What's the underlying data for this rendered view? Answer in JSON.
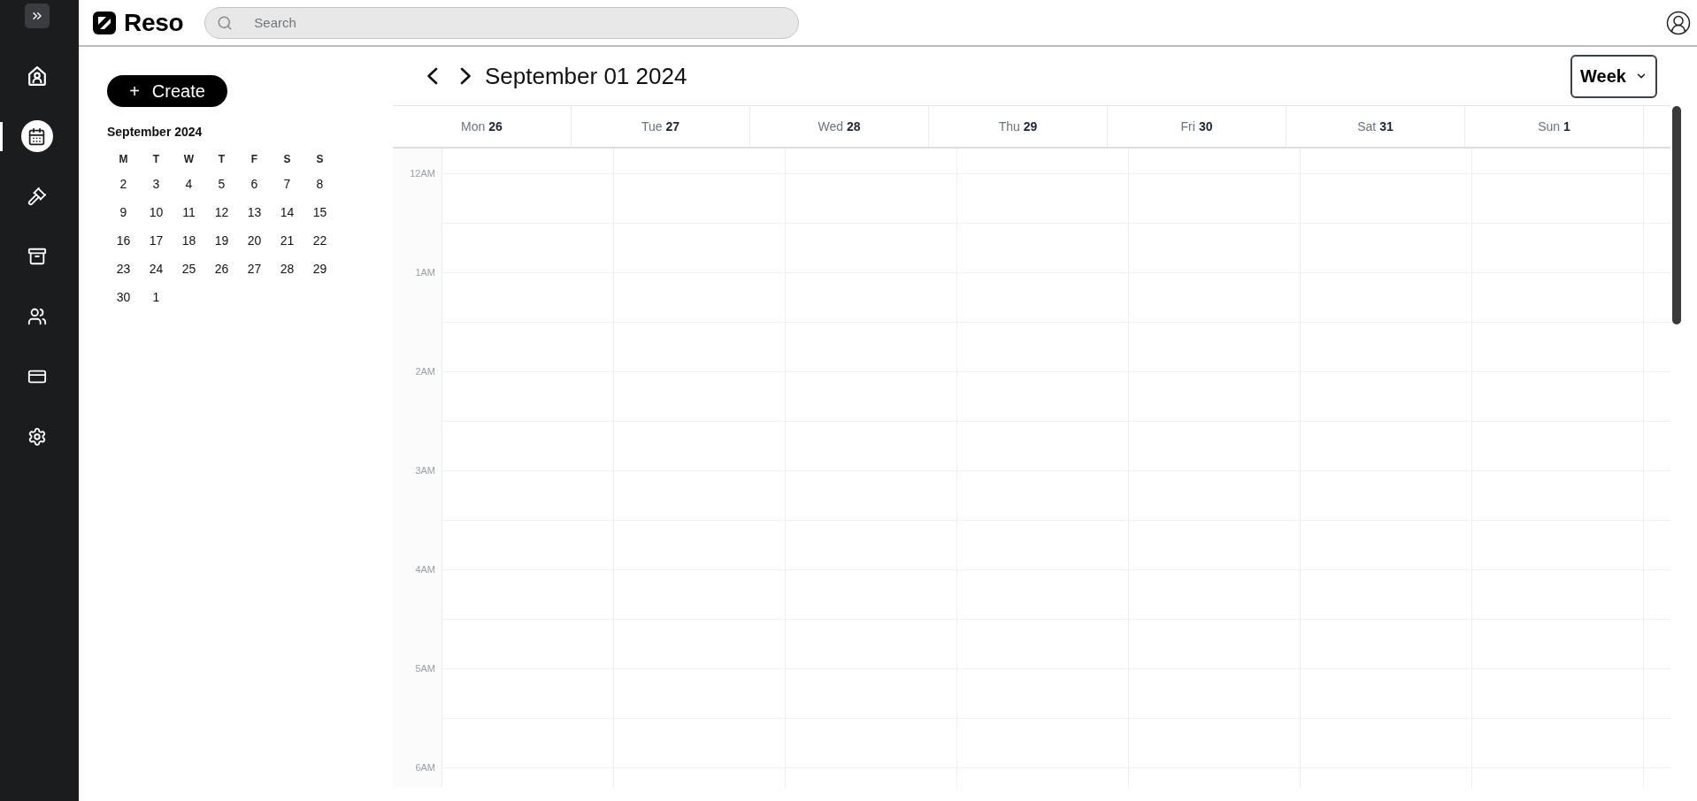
{
  "sidebar": {
    "items": [
      {
        "selected": false
      },
      {
        "selected": true
      },
      {
        "selected": false
      },
      {
        "selected": false
      },
      {
        "selected": false
      },
      {
        "selected": false
      },
      {
        "selected": false
      }
    ]
  },
  "header": {
    "logo": "Reso",
    "search": {
      "placeholder": "Search"
    }
  },
  "create_button": {
    "icon": "+",
    "label": "Create"
  },
  "mini_calendar": {
    "title": "September 2024",
    "weekdays": [
      "M",
      "T",
      "W",
      "T",
      "F",
      "S",
      "S"
    ],
    "weeks": [
      [
        "2",
        "3",
        "4",
        "5",
        "6",
        "7",
        "8"
      ],
      [
        "9",
        "10",
        "11",
        "12",
        "13",
        "14",
        "15"
      ],
      [
        "16",
        "17",
        "18",
        "19",
        "20",
        "21",
        "22"
      ],
      [
        "23",
        "24",
        "25",
        "26",
        "27",
        "28",
        "29"
      ],
      [
        "30",
        "1"
      ]
    ]
  },
  "calendar": {
    "title": "September 01 2024",
    "view": "Week",
    "days": [
      {
        "name": "Mon",
        "date": "26"
      },
      {
        "name": "Tue",
        "date": "27"
      },
      {
        "name": "Wed",
        "date": "28"
      },
      {
        "name": "Thu",
        "date": "29"
      },
      {
        "name": "Fri",
        "date": "30"
      },
      {
        "name": "Sat",
        "date": "31"
      },
      {
        "name": "Sun",
        "date": "1"
      }
    ],
    "hours": [
      "12AM",
      "1AM",
      "2AM",
      "3AM",
      "4AM",
      "5AM",
      "6AM"
    ]
  }
}
